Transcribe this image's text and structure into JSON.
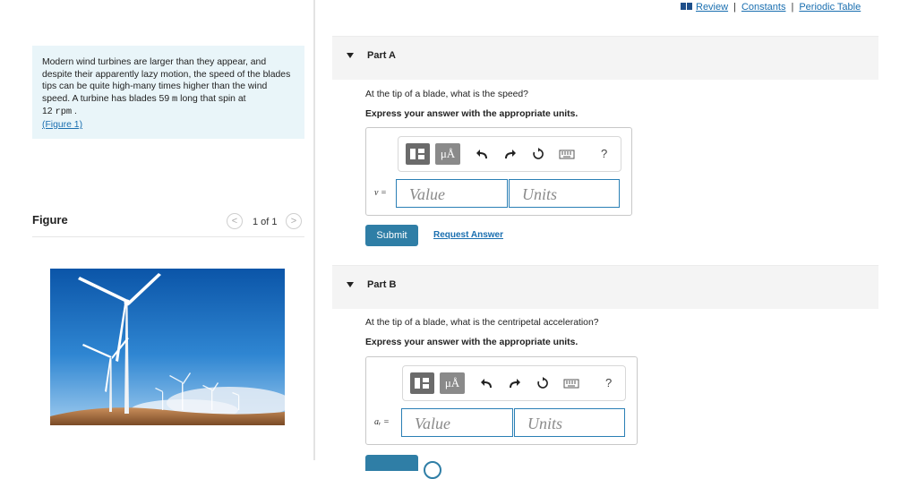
{
  "top_links": {
    "review": "Review",
    "separator": "|",
    "constants": "Constants",
    "periodic_table": "Periodic Table"
  },
  "problem": {
    "text_before_blade_length": "Modern wind turbines are larger than they appear, and despite their apparently lazy motion, the speed of the blades tips can be quite high-many times higher than the wind speed. A turbine has blades 59 ",
    "blade_length_unit": "m",
    "text_between": " long that spin at ",
    "spin_value": "12 ",
    "spin_unit": "rpm",
    "text_after": " .",
    "figure_link": "(Figure 1)"
  },
  "figure": {
    "title": "Figure",
    "page_label": "1 of 1",
    "prev": "<",
    "next": ">"
  },
  "part_a": {
    "label": "Part A",
    "question": "At the tip of a blade, what is the speed?",
    "instruction": "Express your answer with the appropriate units.",
    "var_label": "v =",
    "value_placeholder": "Value",
    "units_placeholder": "Units",
    "ua_label": "μÅ",
    "help_label": "?",
    "submit": "Submit",
    "request_answer": "Request Answer"
  },
  "part_b": {
    "label": "Part B",
    "question": "At the tip of a blade, what is the centripetal acceleration?",
    "instruction": "Express your answer with the appropriate units.",
    "var_label": "aᵣ =",
    "value_placeholder": "Value",
    "units_placeholder": "Units",
    "ua_label": "μÅ",
    "help_label": "?"
  },
  "colors": {
    "accent": "#2f7ea6",
    "link": "#1a6fb0",
    "problem_bg": "#e9f5f9",
    "field_border": "#2a7fb5"
  }
}
